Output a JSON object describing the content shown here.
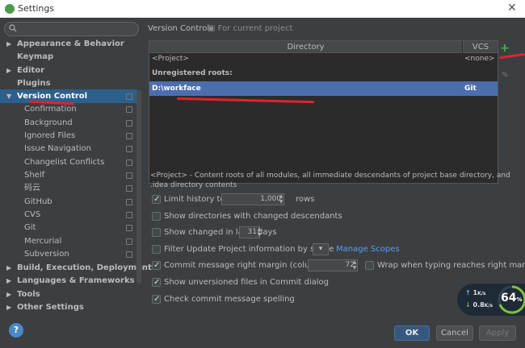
{
  "window": {
    "title": "Settings"
  },
  "sidebar": {
    "search_placeholder": "",
    "items": [
      {
        "label": "Appearance & Behavior",
        "expanded": false,
        "bold": true
      },
      {
        "label": "Keymap",
        "bold": true
      },
      {
        "label": "Editor",
        "expanded": false,
        "bold": true
      },
      {
        "label": "Plugins",
        "bold": true
      },
      {
        "label": "Version Control",
        "expanded": true,
        "bold": true,
        "selected": true
      },
      {
        "label": "Confirmation"
      },
      {
        "label": "Background"
      },
      {
        "label": "Ignored Files"
      },
      {
        "label": "Issue Navigation"
      },
      {
        "label": "Changelist Conflicts"
      },
      {
        "label": "Shelf"
      },
      {
        "label": "码云"
      },
      {
        "label": "GitHub"
      },
      {
        "label": "CVS"
      },
      {
        "label": "Git"
      },
      {
        "label": "Mercurial"
      },
      {
        "label": "Subversion"
      },
      {
        "label": "Build, Execution, Deployment",
        "expanded": false,
        "bold": true
      },
      {
        "label": "Languages & Frameworks",
        "expanded": false,
        "bold": true
      },
      {
        "label": "Tools",
        "expanded": false,
        "bold": true
      },
      {
        "label": "Other Settings",
        "expanded": false,
        "bold": true
      }
    ]
  },
  "main": {
    "title": "Version Control",
    "subtitle": "For current project",
    "table": {
      "columns": [
        "Directory",
        "VCS"
      ],
      "rows": [
        {
          "directory": "<Project>",
          "vcs": "<none>"
        },
        {
          "section": "Unregistered roots:"
        },
        {
          "directory": "D:\\workface",
          "vcs": "Git",
          "selected": true
        }
      ]
    },
    "description": "<Project> - Content roots of all modules, all immediate descendants of project base directory, and .idea directory contents",
    "options": {
      "limit_history": {
        "label": "Limit history to:",
        "checked": true,
        "value": "1,000",
        "suffix": "rows"
      },
      "show_dirs": {
        "label": "Show directories with changed descendants",
        "checked": false
      },
      "show_changed": {
        "label": "Show changed in last",
        "checked": false,
        "value": "31",
        "suffix": "days"
      },
      "filter_update": {
        "label": "Filter Update Project information by scope",
        "checked": false,
        "link": "Manage Scopes"
      },
      "commit_margin": {
        "label": "Commit message right margin (columns):",
        "checked": true,
        "value": "72"
      },
      "wrap_typing": {
        "label": "Wrap when typing reaches right margin",
        "checked": false
      },
      "show_unversioned": {
        "label": "Show unversioned files in Commit dialog",
        "checked": true
      },
      "check_spelling": {
        "label": "Check commit message spelling",
        "checked": true
      }
    }
  },
  "buttons": {
    "ok": "OK",
    "cancel": "Cancel",
    "apply": "Apply",
    "help": "?"
  },
  "net_monitor": {
    "up": "1",
    "up_unit": "K/s",
    "down": "0.8",
    "down_unit": "K/s",
    "percent": "64",
    "percent_unit": "%"
  },
  "colors": {
    "accent": "#4b6eaf",
    "annotation": "#e0232d",
    "add": "#4caf50"
  }
}
